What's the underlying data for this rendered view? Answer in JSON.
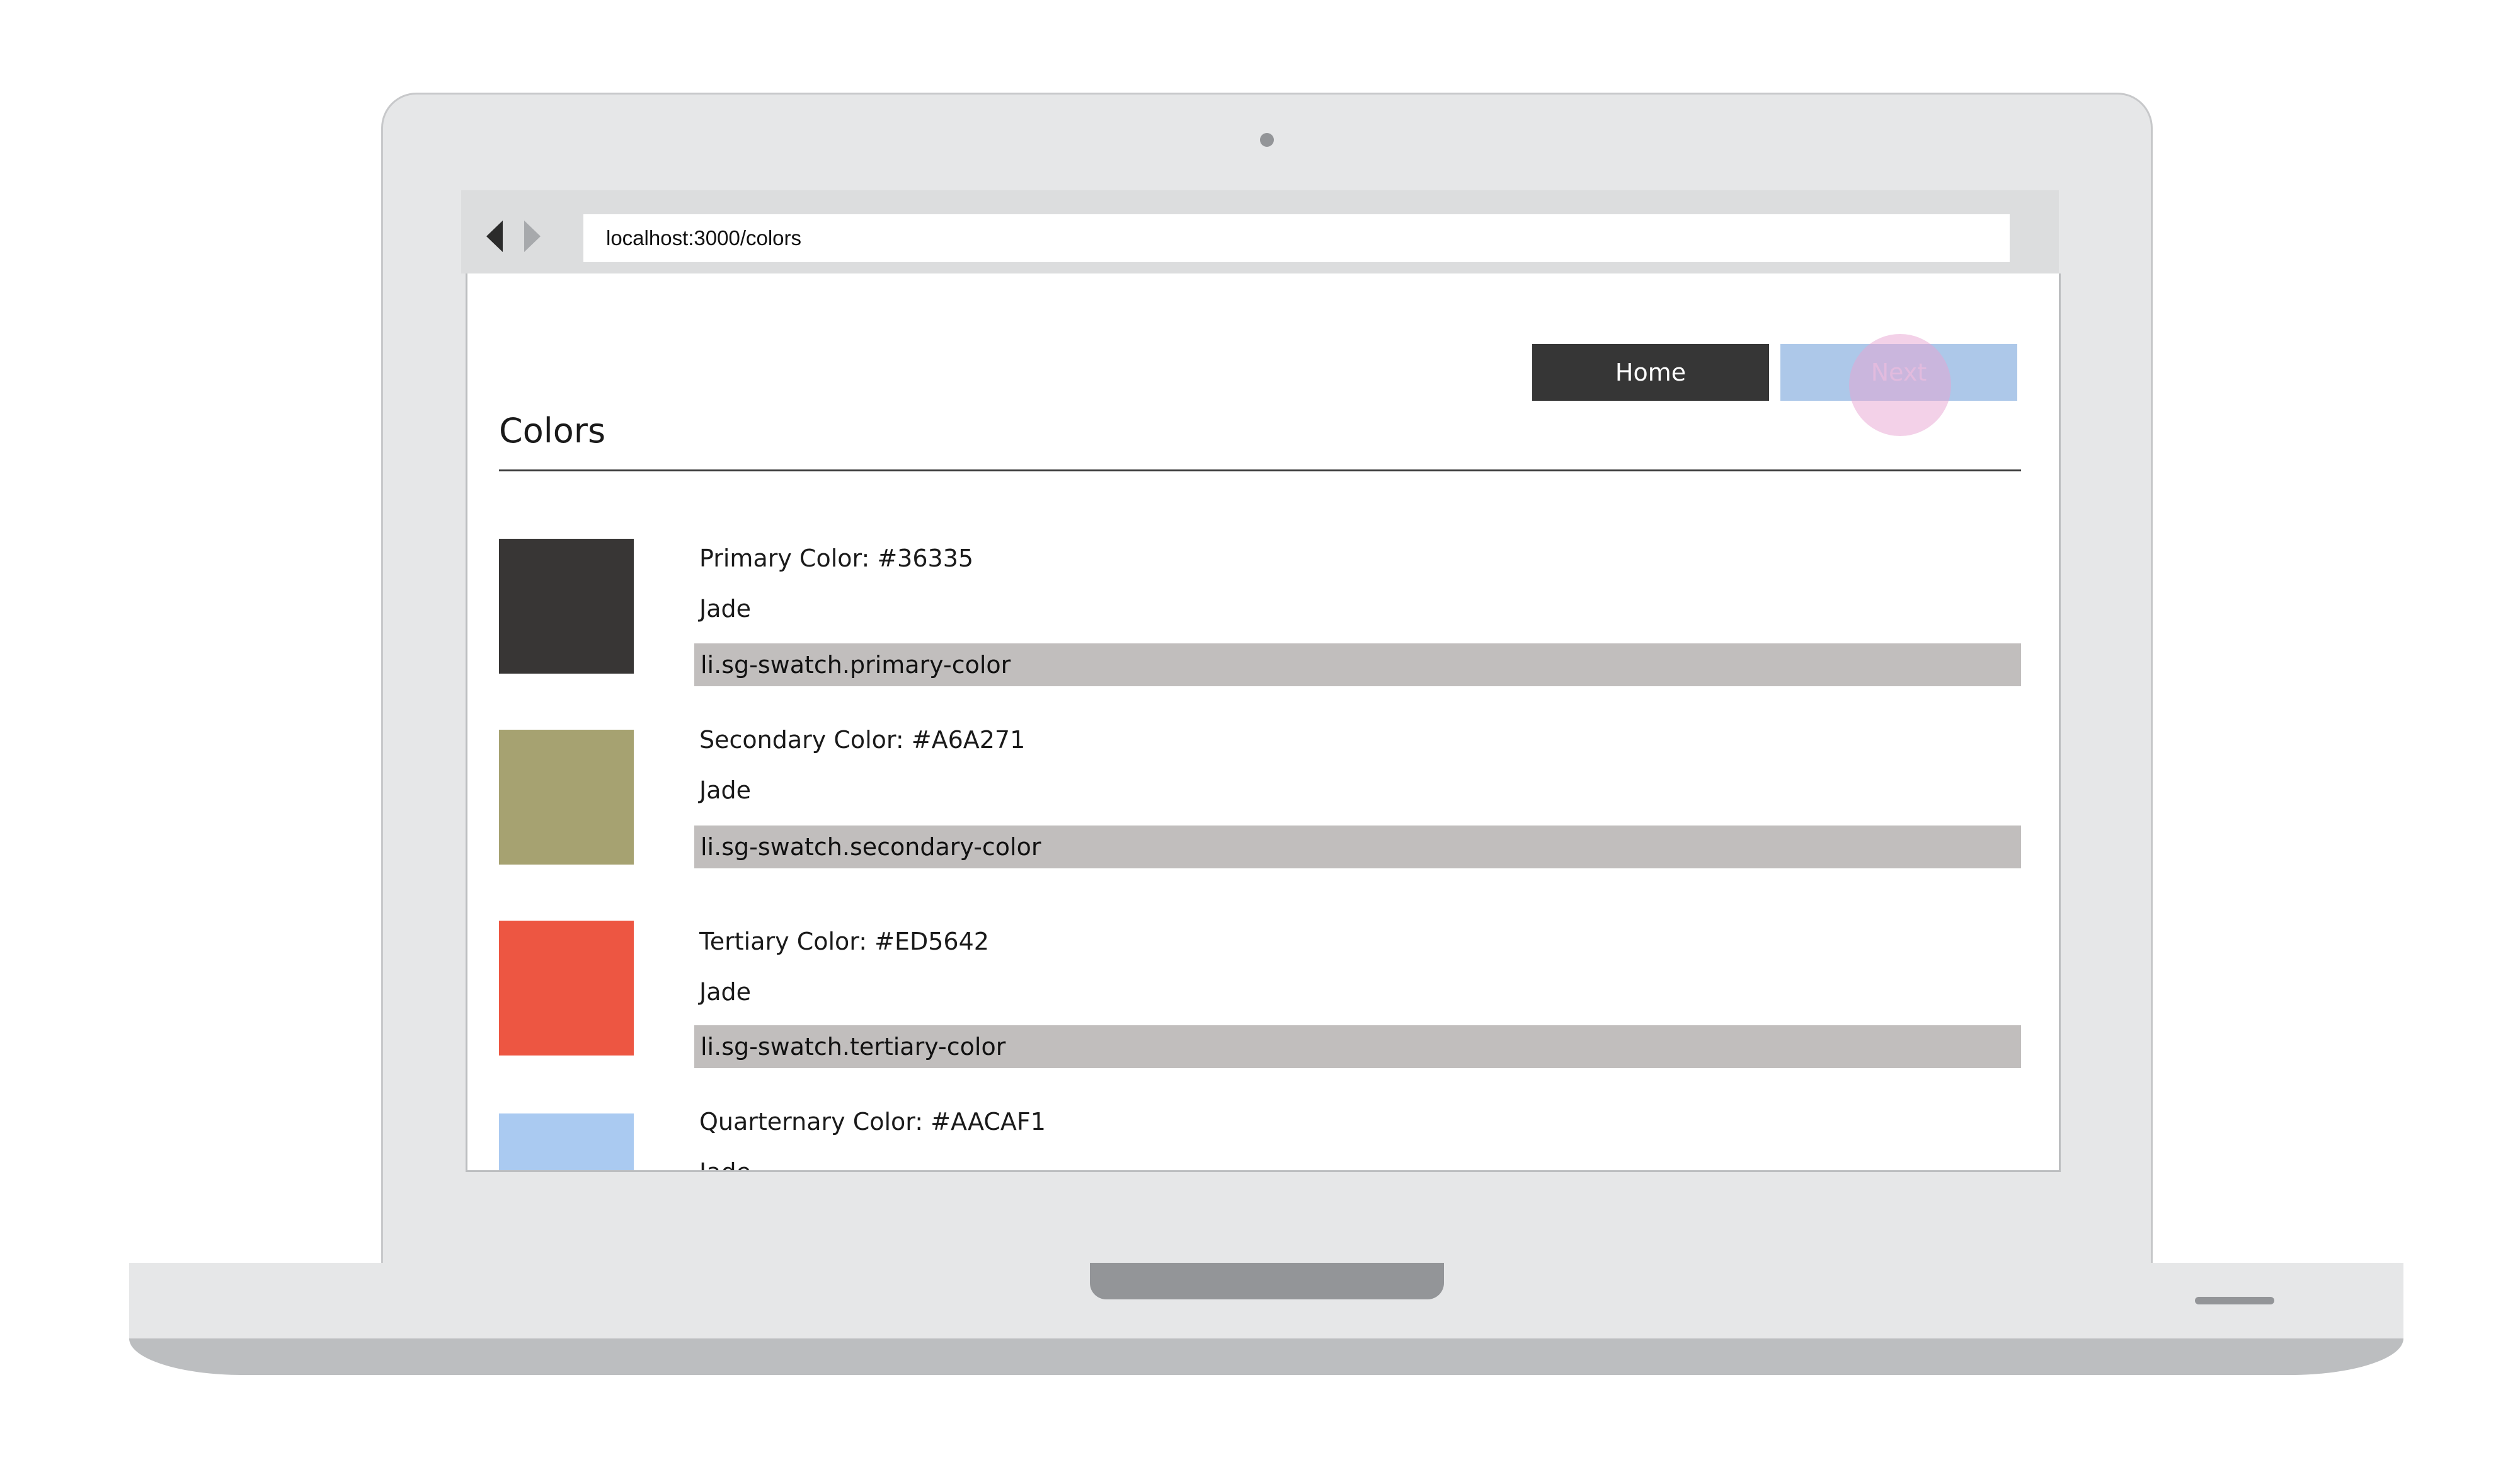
{
  "browser": {
    "url": "localhost:3000/colors"
  },
  "nav": {
    "home_label": "Home",
    "next_label": "Next"
  },
  "page": {
    "title": "Colors"
  },
  "swatches": [
    {
      "name": "Primary Color: #36335",
      "label": "Jade",
      "selector": "li.sg-swatch.primary-color",
      "color": "#383635"
    },
    {
      "name": "Secondary Color: #A6A271",
      "label": "Jade",
      "selector": "li.sg-swatch.secondary-color",
      "color": "#a6a271"
    },
    {
      "name": "Tertiary Color: #ED5642",
      "label": "Jade",
      "selector": "li.sg-swatch.tertiary-color",
      "color": "#ed5642"
    },
    {
      "name": "Quarternary Color: #AACAF1",
      "label": "Jade",
      "selector": "",
      "color": "#aacaf1"
    }
  ],
  "colors": {
    "home_button_bg": "#363636",
    "next_button_bg": "#adc8e9",
    "code_bar_bg": "#c1bebd",
    "device_frame": "#e6e7e8"
  }
}
